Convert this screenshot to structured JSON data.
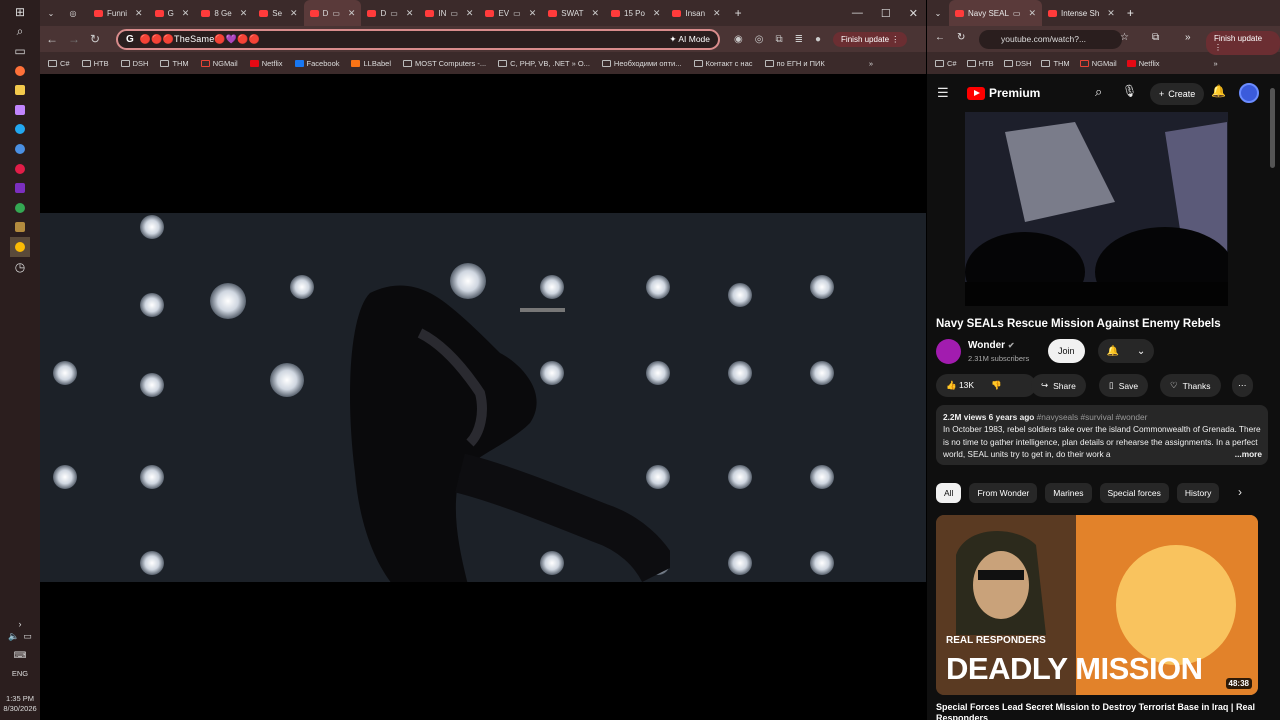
{
  "taskbar": {
    "lang": "ENG",
    "time": "1:35 PM",
    "date": "8/30/2026"
  },
  "left_browser": {
    "tabs": [
      {
        "label": "Funni"
      },
      {
        "label": "G"
      },
      {
        "label": "8 Ge"
      },
      {
        "label": "Se"
      },
      {
        "label": "D"
      },
      {
        "label": "D"
      },
      {
        "label": "IN"
      },
      {
        "label": "EV"
      },
      {
        "label": "SWAT"
      },
      {
        "label": "15 Po"
      },
      {
        "label": "Insan"
      }
    ],
    "omnibox_text": "🔴🔴🔴TheSame🔴💜🔴🔴",
    "ai_mode": "AI Mode",
    "finish_update": "Finish update",
    "bookmarks": [
      "C#",
      "HTB",
      "DSH",
      "THM",
      "NGMail",
      "Netflix",
      "Facebook",
      "LLBabel",
      "MOST Computers -...",
      "C, PHP, VB, .NET » O...",
      "Необходими опти...",
      "Контакт с нас",
      "по ЕГН и ПИК"
    ]
  },
  "right_browser": {
    "tabs": [
      {
        "label": "Navy SEAL"
      },
      {
        "label": "Intense Sh"
      }
    ],
    "url": "youtube.com/watch?...",
    "finish_update": "Finish update",
    "bookmarks": [
      "C#",
      "HTB",
      "DSH",
      "THM",
      "NGMail",
      "Netflix"
    ],
    "youtube": {
      "logo": "Premium",
      "create": "Create",
      "video_title": "Navy SEALs Rescue Mission Against Enemy Rebels",
      "channel": "Wonder",
      "subscribers": "2.31M subscribers",
      "join": "Join",
      "likes": "13K",
      "share": "Share",
      "save": "Save",
      "thanks": "Thanks",
      "views": "2.2M views",
      "age": "6 years ago",
      "tags": "#navyseals #survival #wonder",
      "description": "In October 1983, rebel soldiers take over the island Commonwealth of Grenada. There is no time to gather intelligence, plan details or rehearse the assignments. In a perfect world, SEAL units try to get in, do their work a",
      "more": "...more",
      "chips": [
        "All",
        "From Wonder",
        "Marines",
        "Special forces",
        "History"
      ],
      "rec": {
        "thumb_small": "REAL RESPONDERS",
        "thumb_big": "DEADLY MISSION",
        "duration": "48:38",
        "title": "Special Forces Lead Secret Mission to Destroy Terrorist Base in Iraq | Real Responders"
      }
    }
  },
  "colors": {
    "yt_red": "#ff0000",
    "chrome_frame": "#3b2a2a",
    "chrome_toolbar": "#4a3434",
    "accent_pink": "#d98c8c"
  }
}
